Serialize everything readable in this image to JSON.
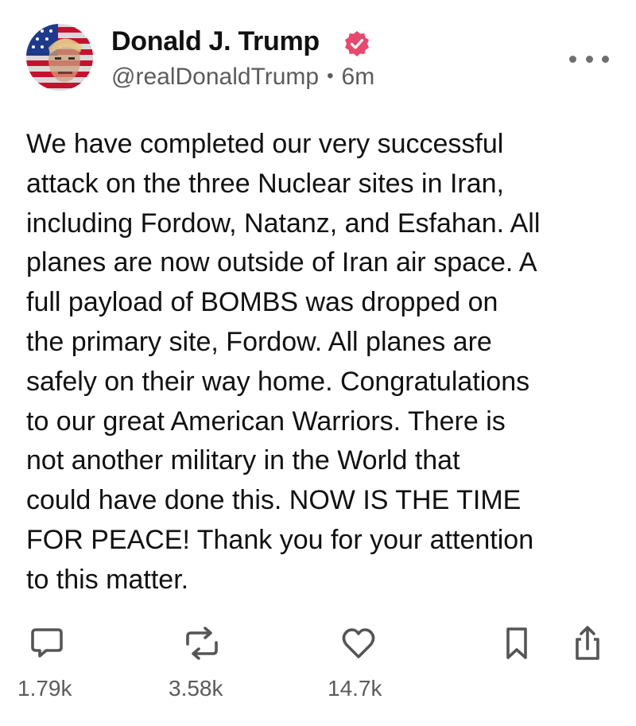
{
  "author": {
    "display_name": "Donald J. Trump",
    "handle": "@realDonaldTrump",
    "separator": "•",
    "timestamp": "6m",
    "verified": true,
    "verified_color": "#e8486e"
  },
  "post": {
    "lines": [
      "We have completed our very successful",
      "attack on the three Nuclear sites in Iran,",
      "including Fordow, Natanz, and Esfahan. All",
      "planes are now outside of Iran air space. A",
      "full payload of BOMBS was dropped on",
      "the primary site, Fordow. All planes are",
      "safely on their way home. Congratulations",
      "to our great American Warriors. There is",
      "not another military in the World that",
      "could have done this. NOW IS THE TIME",
      "FOR PEACE! Thank you for your attention",
      "to this matter."
    ]
  },
  "actions": {
    "reply": {
      "icon": "comment-icon",
      "count": "1.79k"
    },
    "retruth": {
      "icon": "repost-icon",
      "count": "3.58k"
    },
    "like": {
      "icon": "heart-icon",
      "count": "14.7k"
    },
    "bookmark": {
      "icon": "bookmark-icon"
    },
    "share": {
      "icon": "share-icon"
    }
  },
  "colors": {
    "text": "#111111",
    "secondary_text": "#5b5b5b",
    "icon": "#555555",
    "badge": "#e8486e"
  }
}
